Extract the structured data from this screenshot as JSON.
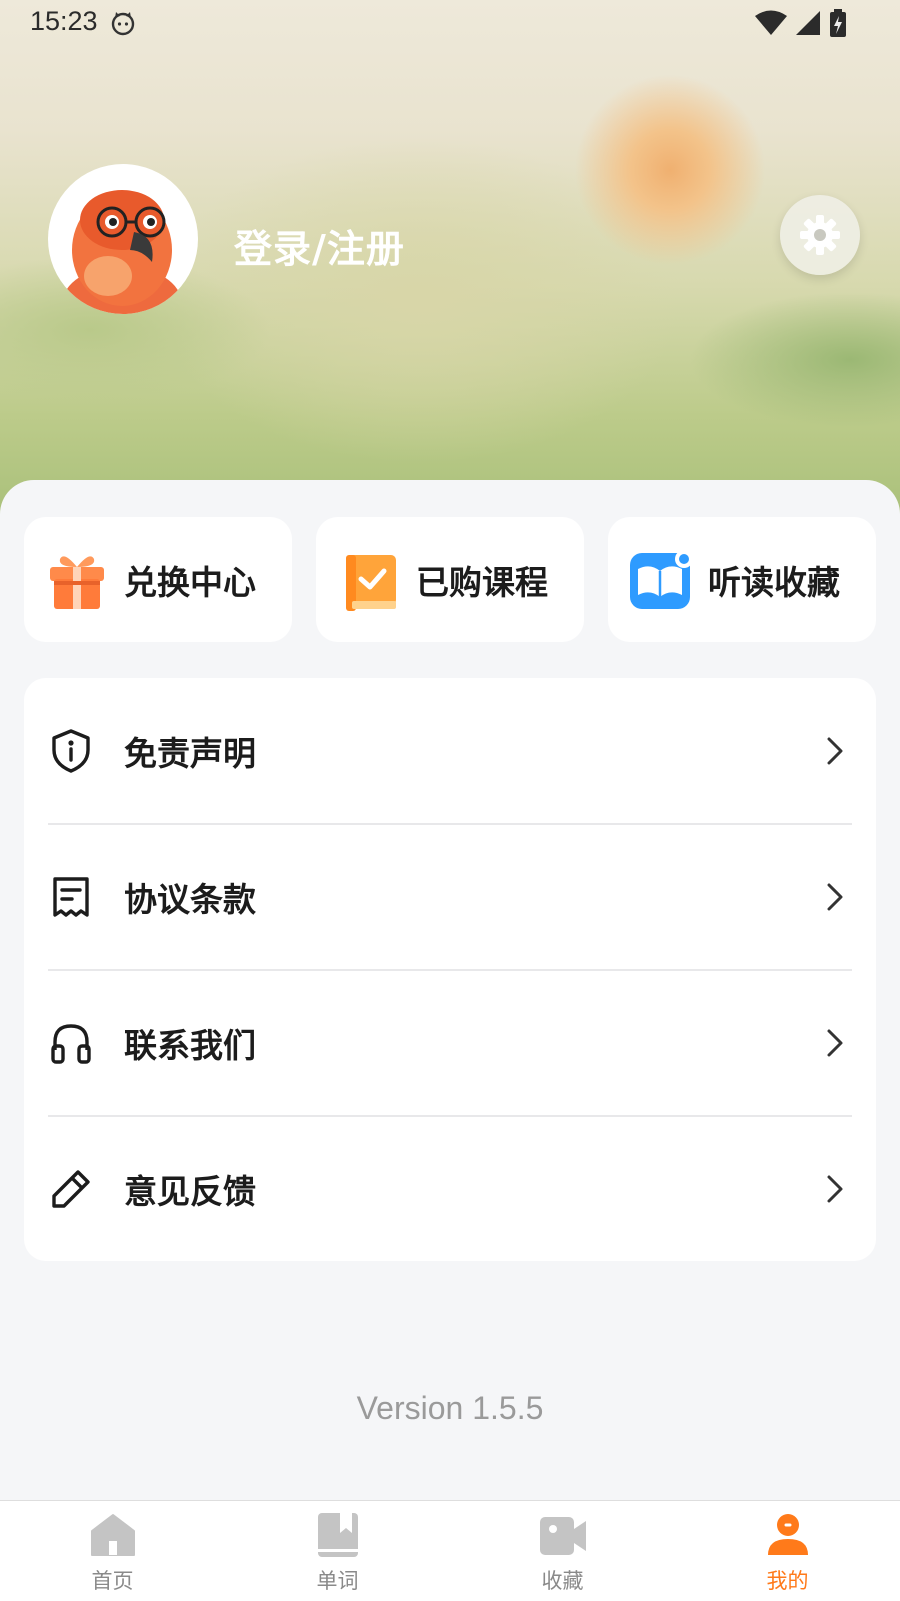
{
  "status_bar": {
    "time": "15:23"
  },
  "profile": {
    "login_text": "登录/注册"
  },
  "quick_actions": [
    {
      "label": "兑换中心",
      "icon": "gift-icon"
    },
    {
      "label": "已购课程",
      "icon": "book-check-icon"
    },
    {
      "label": "听读收藏",
      "icon": "open-book-icon"
    }
  ],
  "menu": [
    {
      "label": "免责声明",
      "icon": "shield-info-icon"
    },
    {
      "label": "协议条款",
      "icon": "receipt-icon"
    },
    {
      "label": "联系我们",
      "icon": "headphones-icon"
    },
    {
      "label": "意见反馈",
      "icon": "pencil-icon"
    }
  ],
  "version": "Version 1.5.5",
  "tabs": [
    {
      "label": "首页",
      "icon": "home-icon"
    },
    {
      "label": "单词",
      "icon": "bookmark-book-icon"
    },
    {
      "label": "收藏",
      "icon": "video-camera-icon"
    },
    {
      "label": "我的",
      "icon": "person-icon",
      "active": true
    }
  ],
  "colors": {
    "accent": "#ff7a1a",
    "tab_inactive": "#8a8a8a",
    "text_primary": "#1c1c1c"
  }
}
